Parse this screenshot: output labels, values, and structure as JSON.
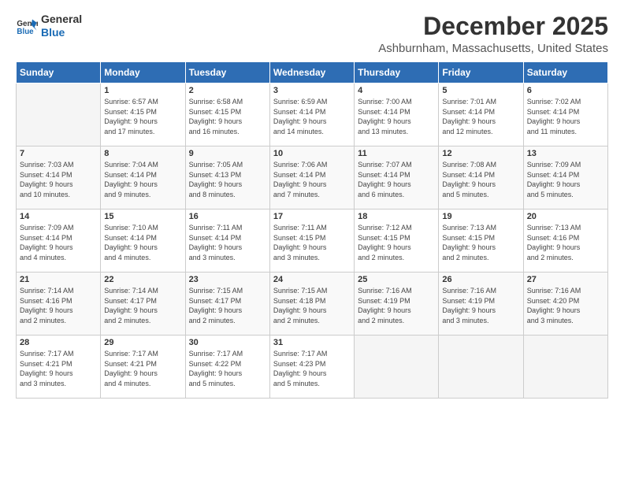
{
  "header": {
    "logo_line1": "General",
    "logo_line2": "Blue",
    "title": "December 2025",
    "location": "Ashburnham, Massachusetts, United States"
  },
  "days_of_week": [
    "Sunday",
    "Monday",
    "Tuesday",
    "Wednesday",
    "Thursday",
    "Friday",
    "Saturday"
  ],
  "weeks": [
    [
      {
        "day": "",
        "info": ""
      },
      {
        "day": "1",
        "info": "Sunrise: 6:57 AM\nSunset: 4:15 PM\nDaylight: 9 hours\nand 17 minutes."
      },
      {
        "day": "2",
        "info": "Sunrise: 6:58 AM\nSunset: 4:15 PM\nDaylight: 9 hours\nand 16 minutes."
      },
      {
        "day": "3",
        "info": "Sunrise: 6:59 AM\nSunset: 4:14 PM\nDaylight: 9 hours\nand 14 minutes."
      },
      {
        "day": "4",
        "info": "Sunrise: 7:00 AM\nSunset: 4:14 PM\nDaylight: 9 hours\nand 13 minutes."
      },
      {
        "day": "5",
        "info": "Sunrise: 7:01 AM\nSunset: 4:14 PM\nDaylight: 9 hours\nand 12 minutes."
      },
      {
        "day": "6",
        "info": "Sunrise: 7:02 AM\nSunset: 4:14 PM\nDaylight: 9 hours\nand 11 minutes."
      }
    ],
    [
      {
        "day": "7",
        "info": "Sunrise: 7:03 AM\nSunset: 4:14 PM\nDaylight: 9 hours\nand 10 minutes."
      },
      {
        "day": "8",
        "info": "Sunrise: 7:04 AM\nSunset: 4:14 PM\nDaylight: 9 hours\nand 9 minutes."
      },
      {
        "day": "9",
        "info": "Sunrise: 7:05 AM\nSunset: 4:13 PM\nDaylight: 9 hours\nand 8 minutes."
      },
      {
        "day": "10",
        "info": "Sunrise: 7:06 AM\nSunset: 4:14 PM\nDaylight: 9 hours\nand 7 minutes."
      },
      {
        "day": "11",
        "info": "Sunrise: 7:07 AM\nSunset: 4:14 PM\nDaylight: 9 hours\nand 6 minutes."
      },
      {
        "day": "12",
        "info": "Sunrise: 7:08 AM\nSunset: 4:14 PM\nDaylight: 9 hours\nand 5 minutes."
      },
      {
        "day": "13",
        "info": "Sunrise: 7:09 AM\nSunset: 4:14 PM\nDaylight: 9 hours\nand 5 minutes."
      }
    ],
    [
      {
        "day": "14",
        "info": "Sunrise: 7:09 AM\nSunset: 4:14 PM\nDaylight: 9 hours\nand 4 minutes."
      },
      {
        "day": "15",
        "info": "Sunrise: 7:10 AM\nSunset: 4:14 PM\nDaylight: 9 hours\nand 4 minutes."
      },
      {
        "day": "16",
        "info": "Sunrise: 7:11 AM\nSunset: 4:14 PM\nDaylight: 9 hours\nand 3 minutes."
      },
      {
        "day": "17",
        "info": "Sunrise: 7:11 AM\nSunset: 4:15 PM\nDaylight: 9 hours\nand 3 minutes."
      },
      {
        "day": "18",
        "info": "Sunrise: 7:12 AM\nSunset: 4:15 PM\nDaylight: 9 hours\nand 2 minutes."
      },
      {
        "day": "19",
        "info": "Sunrise: 7:13 AM\nSunset: 4:15 PM\nDaylight: 9 hours\nand 2 minutes."
      },
      {
        "day": "20",
        "info": "Sunrise: 7:13 AM\nSunset: 4:16 PM\nDaylight: 9 hours\nand 2 minutes."
      }
    ],
    [
      {
        "day": "21",
        "info": "Sunrise: 7:14 AM\nSunset: 4:16 PM\nDaylight: 9 hours\nand 2 minutes."
      },
      {
        "day": "22",
        "info": "Sunrise: 7:14 AM\nSunset: 4:17 PM\nDaylight: 9 hours\nand 2 minutes."
      },
      {
        "day": "23",
        "info": "Sunrise: 7:15 AM\nSunset: 4:17 PM\nDaylight: 9 hours\nand 2 minutes."
      },
      {
        "day": "24",
        "info": "Sunrise: 7:15 AM\nSunset: 4:18 PM\nDaylight: 9 hours\nand 2 minutes."
      },
      {
        "day": "25",
        "info": "Sunrise: 7:16 AM\nSunset: 4:19 PM\nDaylight: 9 hours\nand 2 minutes."
      },
      {
        "day": "26",
        "info": "Sunrise: 7:16 AM\nSunset: 4:19 PM\nDaylight: 9 hours\nand 3 minutes."
      },
      {
        "day": "27",
        "info": "Sunrise: 7:16 AM\nSunset: 4:20 PM\nDaylight: 9 hours\nand 3 minutes."
      }
    ],
    [
      {
        "day": "28",
        "info": "Sunrise: 7:17 AM\nSunset: 4:21 PM\nDaylight: 9 hours\nand 3 minutes."
      },
      {
        "day": "29",
        "info": "Sunrise: 7:17 AM\nSunset: 4:21 PM\nDaylight: 9 hours\nand 4 minutes."
      },
      {
        "day": "30",
        "info": "Sunrise: 7:17 AM\nSunset: 4:22 PM\nDaylight: 9 hours\nand 5 minutes."
      },
      {
        "day": "31",
        "info": "Sunrise: 7:17 AM\nSunset: 4:23 PM\nDaylight: 9 hours\nand 5 minutes."
      },
      {
        "day": "",
        "info": ""
      },
      {
        "day": "",
        "info": ""
      },
      {
        "day": "",
        "info": ""
      }
    ]
  ]
}
